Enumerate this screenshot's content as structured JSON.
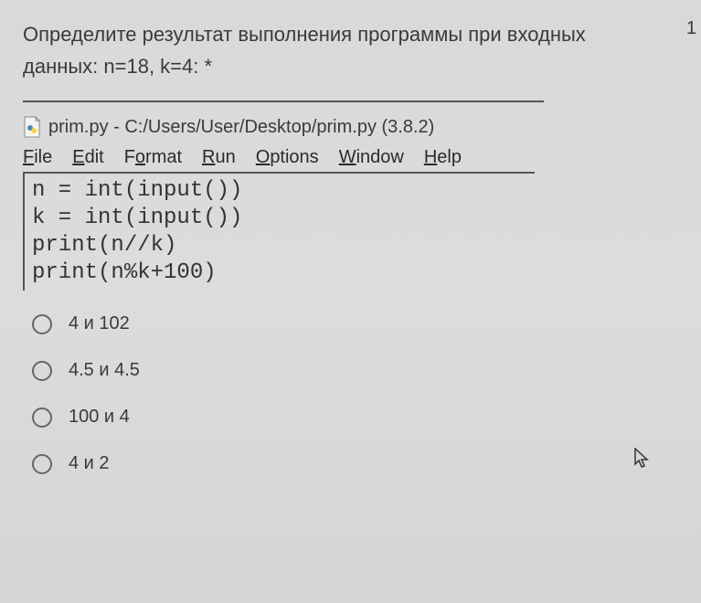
{
  "question": {
    "text_line1": "Определите результат выполнения программы при входных",
    "text_line2": "данных: n=18, k=4: *",
    "points": "1"
  },
  "window": {
    "title": "prim.py - C:/Users/User/Desktop/prim.py (3.8.2)"
  },
  "menu": {
    "file": "File",
    "edit": "Edit",
    "format": "Format",
    "run": "Run",
    "options": "Options",
    "window": "Window",
    "help": "Help"
  },
  "code": {
    "line1": "n = int(input())",
    "line2": "k = int(input())",
    "line3": "print(n//k)",
    "line4": "print(n%k+100)"
  },
  "options": {
    "opt1": "4 и 102",
    "opt2": "4.5 и 4.5",
    "opt3": "100 и 4",
    "opt4": "4 и 2"
  }
}
